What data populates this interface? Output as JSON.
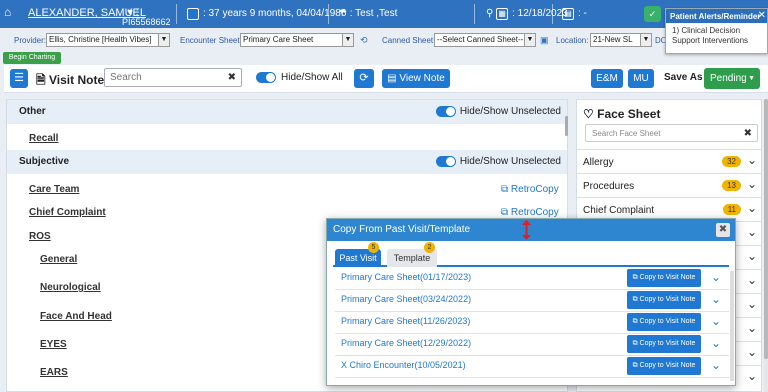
{
  "banner": {
    "name": "ALEXANDER, SAMUEL",
    "id": "PI65568662",
    "age": ": 37 years 9 months, 04/04/1986",
    "insurance": ": Test ,Test",
    "date": ": 12/18/2023",
    "misc": ": -",
    "colors": {
      "bg": "#2f73c0"
    }
  },
  "alert": {
    "title": "Patient Alerts/Reminder",
    "body": "1) Clinical Decision Support Interventions"
  },
  "toolbar": {
    "provider_label": "Provider:",
    "provider_value": "Ellis, Christine [Health Vibes]",
    "encounter_label": "Encounter Sheet:",
    "encounter_value": "Primary Care Sheet",
    "canned_label": "Canned Sheet:",
    "canned_value": "--Select Canned Sheet--",
    "location_label": "Location:",
    "location_value": "21-New SL",
    "dos_label": "DO",
    "begin_label": "Begin Charting"
  },
  "visitnote": {
    "title": "Visit Note",
    "search_placeholder": "Search",
    "hide_show_all": "Hide/Show All",
    "view_note": "View Note",
    "em": "E&M",
    "mu": "MU",
    "save_as": "Save As",
    "status": "Pending"
  },
  "left": {
    "sections": [
      {
        "title": "Other",
        "toggle_label": "Hide/Show Unselected"
      },
      {
        "title": "Subjective",
        "toggle_label": "Hide/Show Unselected"
      }
    ],
    "items": [
      "Recall",
      "Care Team",
      "Chief Complaint",
      "ROS",
      "General",
      "Neurological",
      "Face And Head",
      "EYES",
      "EARS"
    ],
    "retrocopy": "RetroCopy"
  },
  "facesheet": {
    "title": "Face Sheet",
    "search_placeholder": "Search Face Sheet",
    "rows": [
      {
        "label": "Allergy",
        "count": "32"
      },
      {
        "label": "Procedures",
        "count": "13"
      },
      {
        "label": "Chief Complaint",
        "count": "11"
      }
    ]
  },
  "modal": {
    "title": "Copy From Past Visit/Template",
    "tabs": [
      {
        "label": "Past Visit",
        "badge": "5"
      },
      {
        "label": "Template",
        "badge": "2"
      }
    ],
    "rows": [
      "Primary Care Sheet(01/17/2023)",
      "Primary Care Sheet(03/24/2022)",
      "Primary Care Sheet(11/26/2023)",
      "Primary Care Sheet(12/29/2022)",
      "X Chiro Encounter(10/05/2021)"
    ],
    "copy_label": "Copy to Visit Note"
  }
}
